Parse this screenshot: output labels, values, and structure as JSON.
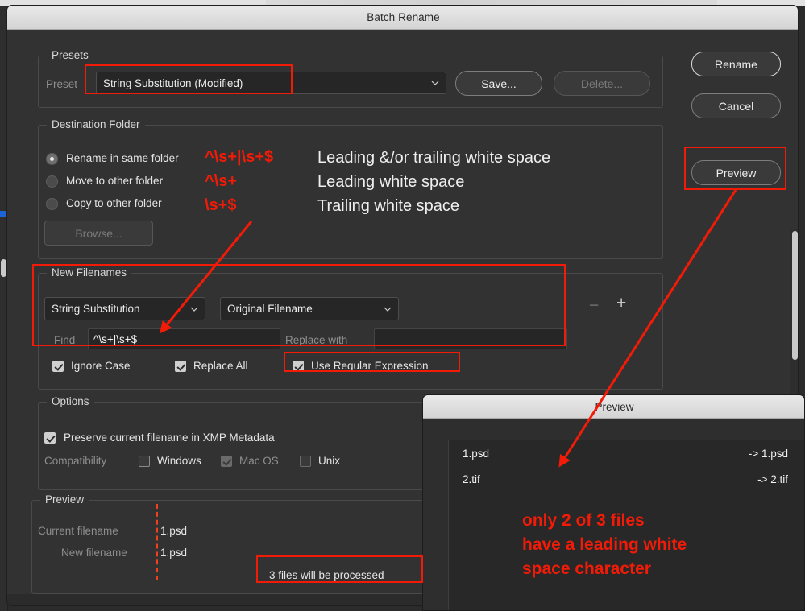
{
  "window": {
    "title": "Batch Rename"
  },
  "presets": {
    "group_title": "Presets",
    "preset_label": "Preset",
    "preset_value": "String Substitution (Modified)",
    "save_label": "Save...",
    "delete_label": "Delete..."
  },
  "action_buttons": {
    "rename": "Rename",
    "cancel": "Cancel",
    "preview": "Preview"
  },
  "destination": {
    "group_title": "Destination Folder",
    "options": [
      {
        "label": "Rename in same folder",
        "selected": true
      },
      {
        "label": "Move to other folder",
        "selected": false
      },
      {
        "label": "Copy to other folder",
        "selected": false
      }
    ],
    "browse_label": "Browse..."
  },
  "regex_notes": [
    {
      "pattern": "^\\s+|\\s+$",
      "description": "Leading &/or trailing white space"
    },
    {
      "pattern": "^\\s+",
      "description": "Leading white space"
    },
    {
      "pattern": "\\s+$",
      "description": "Trailing white space"
    }
  ],
  "new_filenames": {
    "group_title": "New Filenames",
    "rule_type": "String Substitution",
    "rule_source": "Original Filename",
    "find_label": "Find",
    "find_value": "^\\s+|\\s+$",
    "replace_label": "Replace with",
    "replace_value": "",
    "minus_label": "−",
    "plus_label": "+",
    "checkboxes": [
      {
        "label": "Ignore Case",
        "checked": true
      },
      {
        "label": "Replace All",
        "checked": true
      },
      {
        "label": "Use Regular Expression",
        "checked": true
      }
    ]
  },
  "options": {
    "group_title": "Options",
    "preserve_label": "Preserve current filename in XMP Metadata",
    "preserve_checked": true,
    "compatibility_label": "Compatibility",
    "compatibility": [
      {
        "label": "Windows",
        "checked": false,
        "disabled": false
      },
      {
        "label": "Mac OS",
        "checked": true,
        "disabled": true
      },
      {
        "label": "Unix",
        "checked": false,
        "disabled": false
      }
    ]
  },
  "preview_section": {
    "group_title": "Preview",
    "current_filename_label": "Current filename",
    "current_filename_value": "1.psd",
    "new_filename_label": "New filename",
    "new_filename_value": "1.psd",
    "files_status": "3 files will be processed"
  },
  "preview_window": {
    "title": "Preview",
    "rows": [
      {
        "from": "1.psd",
        "to": "-> 1.psd"
      },
      {
        "from": "2.tif",
        "to": "-> 2.tif"
      }
    ],
    "annotation": "only 2 of 3 files\nhave a leading white\nspace character"
  },
  "colors": {
    "annotation_red": "#f21b07",
    "dialog_bg": "#323232",
    "field_bg": "#262626"
  }
}
